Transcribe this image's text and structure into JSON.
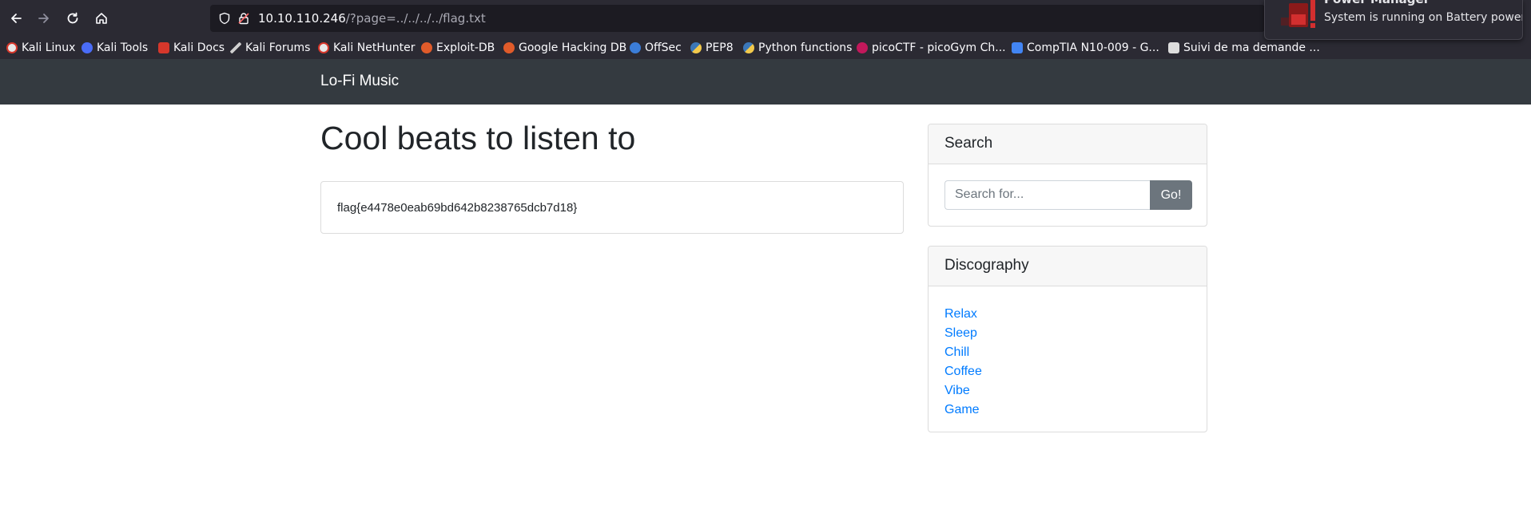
{
  "browser": {
    "url_host": "10.10.110.246",
    "url_path": "/?page=../../../../flag.txt",
    "bookmarks": [
      {
        "label": "Kali Linux",
        "icon": "kali-icon",
        "color": "#e8e8e8"
      },
      {
        "label": "Kali Tools",
        "icon": "kali-tools-icon",
        "color": "#4a6cf7"
      },
      {
        "label": "Kali Docs",
        "icon": "kali-docs-icon",
        "color": "#d6372b"
      },
      {
        "label": "Kali Forums",
        "icon": "kali-forums-icon",
        "color": "#1a1a1a"
      },
      {
        "label": "Kali NetHunter",
        "icon": "kali-nethunter-icon",
        "color": "#e8e8e8"
      },
      {
        "label": "Exploit-DB",
        "icon": "exploit-db-icon",
        "color": "#e05b2a"
      },
      {
        "label": "Google Hacking DB",
        "icon": "ghdb-icon",
        "color": "#e05b2a"
      },
      {
        "label": "OffSec",
        "icon": "offsec-icon",
        "color": "#3b7dd8"
      },
      {
        "label": "PEP8",
        "icon": "python-icon",
        "color": "#f2c94c"
      },
      {
        "label": "Python functions",
        "icon": "python-icon",
        "color": "#f2c94c"
      },
      {
        "label": "picoCTF - picoGym Ch...",
        "icon": "picoctf-icon",
        "color": "#c2185b"
      },
      {
        "label": "CompTIA N10-009 - G...",
        "icon": "docs-icon",
        "color": "#4285f4"
      },
      {
        "label": "Suivi de ma demande ...",
        "icon": "page-icon",
        "color": "#dddddd"
      }
    ]
  },
  "notification": {
    "title": "Power Manager",
    "text": "System is running on Battery power"
  },
  "site": {
    "brand": "Lo-Fi Music",
    "heading": "Cool beats to listen to",
    "content": "flag{e4478e0eab69bd642b8238765dcb7d18}",
    "search": {
      "title": "Search",
      "placeholder": "Search for...",
      "button": "Go!"
    },
    "discography": {
      "title": "Discography",
      "items": [
        "Relax",
        "Sleep",
        "Chill",
        "Coffee",
        "Vibe",
        "Game"
      ]
    }
  }
}
